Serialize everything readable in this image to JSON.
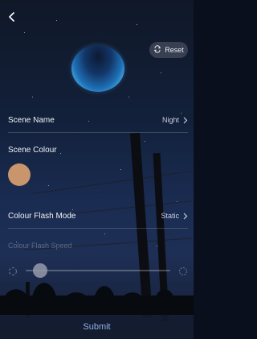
{
  "header": {
    "back_icon": "chevron-left-icon",
    "reset_label": "Reset",
    "reset_icon": "refresh-icon"
  },
  "scene_name": {
    "label": "Scene Name",
    "value": "Night"
  },
  "scene_colour": {
    "label": "Scene Colour",
    "color": "#c8956c"
  },
  "colour_flash_mode": {
    "label": "Colour Flash Mode",
    "value": "Static"
  },
  "colour_flash_speed": {
    "label": "Colour Flash Speed",
    "enabled": false,
    "level": 0.1
  },
  "footer": {
    "submit_label": "Submit"
  },
  "colors": {
    "accent": "#8fb0e8",
    "moon_outer": "#4fb3e8",
    "moon_inner": "#0d1a33"
  }
}
